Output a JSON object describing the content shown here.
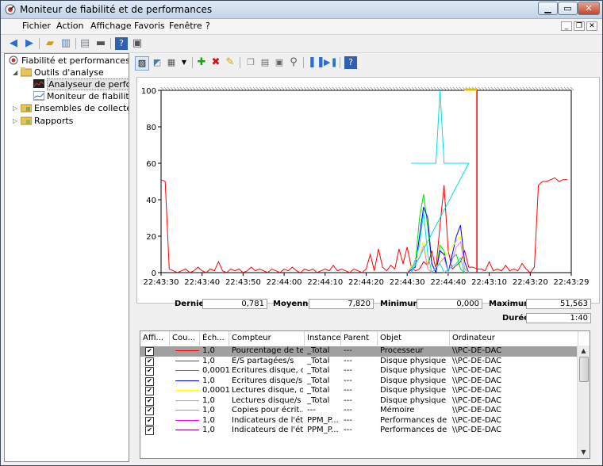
{
  "window": {
    "title": "Moniteur de fiabilité et de performances"
  },
  "menu": [
    "Fichier",
    "Action",
    "Affichage",
    "Favoris",
    "Fenêtre",
    "?"
  ],
  "tree": {
    "root": "Fiabilité et performances",
    "tools": "Outils d'analyse",
    "analyzer": "Analyseur de performances",
    "reliability": "Moniteur de fiabilité",
    "collectors": "Ensembles de collecteurs de données",
    "reports": "Rapports"
  },
  "chart_data": {
    "type": "line",
    "ylim": [
      0,
      100
    ],
    "y_ticks": [
      "100",
      "80",
      "60",
      "40",
      "20",
      "0"
    ],
    "x_ticks": [
      "22:43:30",
      "22:43:40",
      "22:43:50",
      "22:44:00",
      "22:44:10",
      "22:44:20",
      "22:44:30",
      "22:44:40",
      "22:43:10",
      "22:43:20",
      "22:43:29"
    ],
    "cursor_position_seconds": 77,
    "series": [
      {
        "color": "#ff0000",
        "values": [
          [
            0,
            51
          ],
          [
            1,
            50
          ],
          [
            2,
            2
          ],
          [
            3,
            1
          ],
          [
            4,
            0
          ],
          [
            5,
            1
          ],
          [
            6,
            2
          ],
          [
            7,
            0
          ],
          [
            8,
            1
          ],
          [
            9,
            3
          ],
          [
            10,
            1
          ],
          [
            11,
            0
          ],
          [
            12,
            2
          ],
          [
            13,
            1
          ],
          [
            14,
            6
          ],
          [
            15,
            1
          ],
          [
            16,
            0
          ],
          [
            17,
            2
          ],
          [
            18,
            1
          ],
          [
            19,
            2
          ],
          [
            20,
            0
          ],
          [
            21,
            1
          ],
          [
            22,
            3
          ],
          [
            23,
            1
          ],
          [
            24,
            2
          ],
          [
            25,
            1
          ],
          [
            26,
            0
          ],
          [
            27,
            2
          ],
          [
            28,
            1
          ],
          [
            29,
            0
          ],
          [
            30,
            2
          ],
          [
            31,
            1
          ],
          [
            32,
            3
          ],
          [
            33,
            1
          ],
          [
            34,
            0
          ],
          [
            35,
            2
          ],
          [
            36,
            1
          ],
          [
            37,
            2
          ],
          [
            38,
            0
          ],
          [
            39,
            1
          ],
          [
            40,
            2
          ],
          [
            41,
            1
          ],
          [
            42,
            4
          ],
          [
            43,
            1
          ],
          [
            44,
            2
          ],
          [
            45,
            1
          ],
          [
            46,
            0
          ],
          [
            47,
            2
          ],
          [
            48,
            1
          ],
          [
            49,
            0
          ],
          [
            50,
            2
          ],
          [
            51,
            10
          ],
          [
            52,
            1
          ],
          [
            53,
            13
          ],
          [
            54,
            3
          ],
          [
            55,
            1
          ],
          [
            56,
            4
          ],
          [
            57,
            2
          ],
          [
            58,
            13
          ],
          [
            59,
            5
          ],
          [
            60,
            14
          ],
          [
            61,
            3
          ],
          [
            62,
            1
          ],
          [
            63,
            2
          ],
          [
            64,
            6
          ],
          [
            65,
            4
          ],
          [
            66,
            12
          ],
          [
            67,
            2
          ],
          [
            68,
            26
          ],
          [
            69,
            48
          ],
          [
            70,
            12
          ],
          [
            71,
            2
          ],
          [
            72,
            4
          ],
          [
            73,
            6
          ],
          [
            74,
            12
          ],
          [
            75,
            3
          ],
          [
            76,
            3
          ],
          [
            77,
            2
          ],
          [
            78,
            2
          ],
          [
            79,
            1
          ],
          [
            80,
            6
          ],
          [
            81,
            1
          ],
          [
            82,
            2
          ],
          [
            83,
            1
          ],
          [
            84,
            4
          ],
          [
            85,
            1
          ],
          [
            86,
            2
          ],
          [
            87,
            1
          ],
          [
            88,
            5
          ],
          [
            89,
            2
          ],
          [
            90,
            0
          ],
          [
            91,
            3
          ],
          [
            92,
            48
          ],
          [
            93,
            50
          ],
          [
            94,
            50
          ],
          [
            95,
            51
          ],
          [
            96,
            52
          ],
          [
            97,
            50
          ],
          [
            98,
            51
          ],
          [
            99,
            51
          ]
        ]
      },
      {
        "color": "#00e000",
        "values": [
          [
            60,
            0
          ],
          [
            62,
            5
          ],
          [
            63,
            30
          ],
          [
            64,
            43
          ],
          [
            65,
            25
          ],
          [
            66,
            5
          ],
          [
            67,
            0
          ],
          [
            68,
            15
          ],
          [
            69,
            12
          ],
          [
            70,
            0
          ],
          [
            71,
            8
          ],
          [
            72,
            10
          ],
          [
            73,
            2
          ],
          [
            74,
            0
          ]
        ]
      },
      {
        "color": "#0000ff",
        "values": [
          [
            60,
            0
          ],
          [
            62,
            3
          ],
          [
            63,
            20
          ],
          [
            64,
            36
          ],
          [
            65,
            30
          ],
          [
            66,
            5
          ],
          [
            67,
            0
          ],
          [
            68,
            12
          ],
          [
            69,
            10
          ],
          [
            70,
            0
          ],
          [
            72,
            20
          ],
          [
            73,
            26
          ],
          [
            74,
            6
          ],
          [
            75,
            0
          ]
        ]
      },
      {
        "color": "#ffff00",
        "values": [
          [
            60,
            0
          ],
          [
            63,
            10
          ],
          [
            64,
            17
          ],
          [
            65,
            4
          ],
          [
            66,
            0
          ],
          [
            73,
            20
          ],
          [
            74,
            3
          ],
          [
            75,
            0
          ]
        ]
      },
      {
        "color": "#e680ff",
        "values": [
          [
            60,
            0
          ],
          [
            63,
            8
          ],
          [
            64,
            15
          ],
          [
            65,
            2
          ],
          [
            66,
            0
          ],
          [
            69,
            8
          ],
          [
            70,
            0
          ],
          [
            72,
            14
          ],
          [
            73,
            17
          ],
          [
            74,
            2
          ],
          [
            75,
            0
          ]
        ]
      },
      {
        "color": "#00e0e0",
        "values": [
          [
            61,
            60
          ],
          [
            67,
            60
          ],
          [
            68,
            100
          ],
          [
            69,
            60
          ],
          [
            75,
            60
          ],
          [
            61,
            0
          ],
          [
            63,
            15
          ],
          [
            64,
            33
          ],
          [
            65,
            10
          ],
          [
            66,
            0
          ],
          [
            68,
            5
          ],
          [
            69,
            0
          ],
          [
            72,
            5
          ],
          [
            73,
            8
          ],
          [
            74,
            0
          ]
        ]
      }
    ]
  },
  "stats": {
    "last_label": "Dernier",
    "last": "0,781",
    "avg_label": "Moyenne",
    "avg": "7,820",
    "min_label": "Minimum",
    "min": "0,000",
    "max_label": "Maximum",
    "max": "51,563",
    "dur_label": "Durée",
    "dur": "1:40"
  },
  "grid": {
    "headers": [
      "Affi...",
      "Cou...",
      "Éch...",
      "Compteur",
      "Instance",
      "Parent",
      "Objet",
      "Ordinateur"
    ],
    "rows": [
      {
        "color": "#ff0000",
        "scale": "1,0",
        "counter": "Pourcentage de te...",
        "instance": "_Total",
        "parent": "---",
        "object": "Processeur",
        "computer": "\\\\PC-DE-DAC"
      },
      {
        "color": "#ff0000",
        "scale": "1,0",
        "counter": "E/S partagées/s",
        "instance": "_Total",
        "parent": "---",
        "object": "Disque physique",
        "computer": "\\\\PC-DE-DAC"
      },
      {
        "color": "#00cc00",
        "scale": "0,0001",
        "counter": "Écritures disque, o...",
        "instance": "_Total",
        "parent": "---",
        "object": "Disque physique",
        "computer": "\\\\PC-DE-DAC"
      },
      {
        "color": "#0000ff",
        "scale": "1,0",
        "counter": "Écritures disque/s",
        "instance": "_Total",
        "parent": "---",
        "object": "Disque physique",
        "computer": "\\\\PC-DE-DAC"
      },
      {
        "color": "#ffff00",
        "scale": "0,0001",
        "counter": "Lectures disque, o...",
        "instance": "_Total",
        "parent": "---",
        "object": "Disque physique",
        "computer": "\\\\PC-DE-DAC"
      },
      {
        "color": "#e680ff",
        "scale": "1,0",
        "counter": "Lectures disque/s",
        "instance": "_Total",
        "parent": "---",
        "object": "Disque physique",
        "computer": "\\\\PC-DE-DAC"
      },
      {
        "color": "#00e0e0",
        "scale": "1,0",
        "counter": "Copies pour écrit...",
        "instance": "---",
        "parent": "---",
        "object": "Mémoire",
        "computer": "\\\\PC-DE-DAC"
      },
      {
        "color": "#ff00ff",
        "scale": "1,0",
        "counter": "Indicateurs de l'ét...",
        "instance": "PPM_P...",
        "parent": "---",
        "object": "Performances de ...",
        "computer": "\\\\PC-DE-DAC"
      },
      {
        "color": "#800080",
        "scale": "1,0",
        "counter": "Indicateurs de l'ét...",
        "instance": "PPM_P...",
        "parent": "---",
        "object": "Performances de ...",
        "computer": "\\\\PC-DE-DAC"
      }
    ]
  }
}
